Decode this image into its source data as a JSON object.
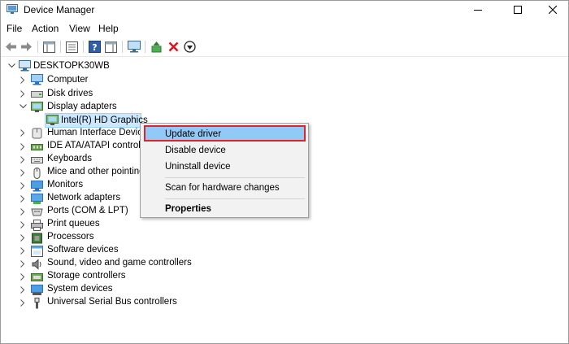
{
  "window": {
    "title": "Device Manager"
  },
  "menubar": {
    "items": [
      "File",
      "Action",
      "View",
      "Help"
    ]
  },
  "toolbar": {
    "icons": [
      "back-arrow-icon",
      "forward-arrow-icon",
      "show-hide-console-tree-icon",
      "properties-icon",
      "help-icon",
      "action-pane-icon",
      "monitor-scan-icon",
      "update-driver-icon",
      "uninstall-x-icon",
      "disable-device-icon"
    ]
  },
  "tree": {
    "root": "DESKTOPK30WB",
    "categories": [
      {
        "label": "Computer",
        "expanded": false
      },
      {
        "label": "Disk drives",
        "expanded": false
      },
      {
        "label": "Display adapters",
        "expanded": true,
        "children": [
          "Intel(R) HD Graphics"
        ]
      },
      {
        "label": "Human Interface Device",
        "expanded": false
      },
      {
        "label": "IDE ATA/ATAPI controlle",
        "expanded": false
      },
      {
        "label": "Keyboards",
        "expanded": false
      },
      {
        "label": "Mice and other pointing",
        "expanded": false
      },
      {
        "label": "Monitors",
        "expanded": false
      },
      {
        "label": "Network adapters",
        "expanded": false
      },
      {
        "label": "Ports (COM & LPT)",
        "expanded": false
      },
      {
        "label": "Print queues",
        "expanded": false
      },
      {
        "label": "Processors",
        "expanded": false
      },
      {
        "label": "Software devices",
        "expanded": false
      },
      {
        "label": "Sound, video and game controllers",
        "expanded": false
      },
      {
        "label": "Storage controllers",
        "expanded": false
      },
      {
        "label": "System devices",
        "expanded": false
      },
      {
        "label": "Universal Serial Bus controllers",
        "expanded": false
      }
    ]
  },
  "context_menu": {
    "items": [
      "Update driver",
      "Disable device",
      "Uninstall device",
      "Scan for hardware changes",
      "Properties"
    ],
    "highlighted": "Update driver",
    "highlight_border_color": "#e0222a",
    "highlight_fill_color": "#91c9f7"
  },
  "colors": {
    "selection": "#cce8ff",
    "accent_icon_blue": "#2f6fbf"
  }
}
